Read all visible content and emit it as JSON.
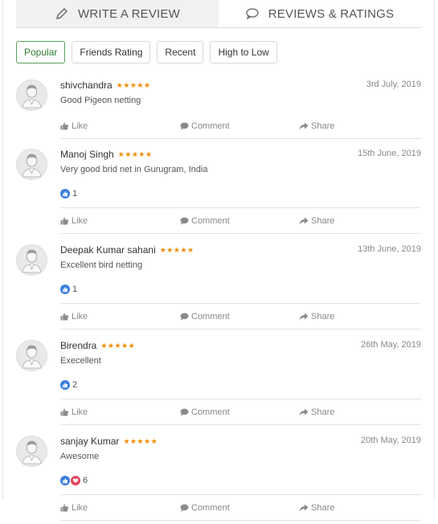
{
  "tabs": [
    {
      "label": "WRITE A REVIEW",
      "icon": "pencil-icon"
    },
    {
      "label": "REVIEWS & RATINGS",
      "icon": "comment-icon"
    }
  ],
  "filters": [
    "Popular",
    "Friends Rating",
    "Recent",
    "High to Low"
  ],
  "active_filter": "Popular",
  "actions": {
    "like": "Like",
    "comment": "Comment",
    "share": "Share"
  },
  "star_rating": "★★★★★",
  "colors": {
    "star": "#f28b00",
    "accent": "#2e7d32",
    "like": "#3b7ddd",
    "love": "#e0455b"
  },
  "reviews": [
    {
      "name": "shivchandra",
      "stars": 5,
      "date": "3rd July, 2019",
      "text": "Good Pigeon netting",
      "reactions": "",
      "reaction_icons": []
    },
    {
      "name": "Manoj Singh",
      "stars": 5,
      "date": "15th June, 2019",
      "text": "Very good brid net in Gurugram, India",
      "reactions": "1",
      "reaction_icons": [
        "like"
      ]
    },
    {
      "name": "Deepak Kumar sahani",
      "stars": 5,
      "date": "13th June, 2019",
      "text": "Excellent bird netting",
      "reactions": "1",
      "reaction_icons": [
        "like"
      ]
    },
    {
      "name": "Birendra",
      "stars": 5,
      "date": "26th May, 2019",
      "text": "Execellent",
      "reactions": "2",
      "reaction_icons": [
        "like"
      ]
    },
    {
      "name": "sanjay Kumar",
      "stars": 5,
      "date": "20th May, 2019",
      "text": "Awesome",
      "reactions": "6",
      "reaction_icons": [
        "like",
        "love"
      ]
    }
  ]
}
